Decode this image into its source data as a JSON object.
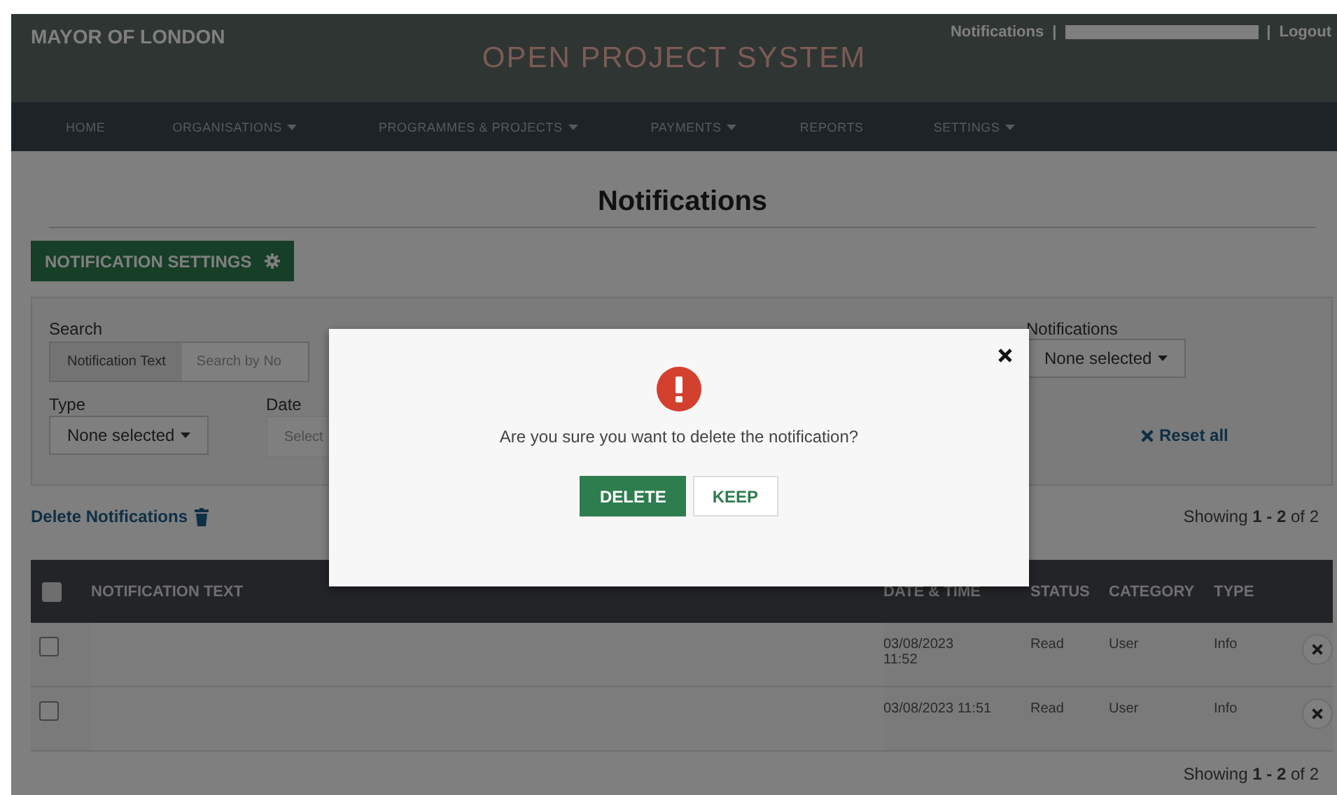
{
  "header": {
    "brand": "MAYOR OF LONDON",
    "title": "OPEN PROJECT SYSTEM",
    "links": [
      {
        "label": "Notifications"
      },
      {
        "label": "Logout"
      }
    ],
    "separator": "|"
  },
  "nav": [
    {
      "label": "HOME",
      "dropdown": false
    },
    {
      "label": "ORGANISATIONS",
      "dropdown": true
    },
    {
      "label": "PROGRAMMES & PROJECTS",
      "dropdown": true
    },
    {
      "label": "PAYMENTS",
      "dropdown": true
    },
    {
      "label": "REPORTS",
      "dropdown": false
    },
    {
      "label": "SETTINGS",
      "dropdown": true
    }
  ],
  "page_title": "Notifications",
  "settings_button": "NOTIFICATION SETTINGS",
  "filters": {
    "search": {
      "label": "Search",
      "addon": "Notification Text",
      "placeholder": "Search by No"
    },
    "notifications": {
      "label": "Notifications",
      "value": "None selected"
    },
    "type": {
      "label": "Type",
      "value": "None selected"
    },
    "date": {
      "label": "Date",
      "placeholder": "Select"
    },
    "reset": "Reset all"
  },
  "delete_link": "Delete Notifications",
  "showing_top": "Showing **1 - 2** of 2",
  "table": {
    "select_all_checked": false,
    "columns": [
      "NOTIFICATION TEXT",
      "DATE & TIME",
      "STATUS",
      "CATEGORY",
      "TYPE"
    ],
    "rows": [
      {
        "checked": false,
        "date": "03/08/2023 11:52",
        "status": "Read",
        "category": "User",
        "type": "Info"
      },
      {
        "checked": false,
        "date": "03/08/2023 11:51",
        "status": "Read",
        "category": "User",
        "type": "Info"
      }
    ]
  },
  "showing_bottom": "Showing **1 - 2** of 2",
  "modal": {
    "message": "Are you sure you want to delete the notification?",
    "buttons": [
      {
        "label": "DELETE",
        "kind": "primary"
      },
      {
        "label": "KEEP",
        "kind": "secondary"
      }
    ]
  }
}
